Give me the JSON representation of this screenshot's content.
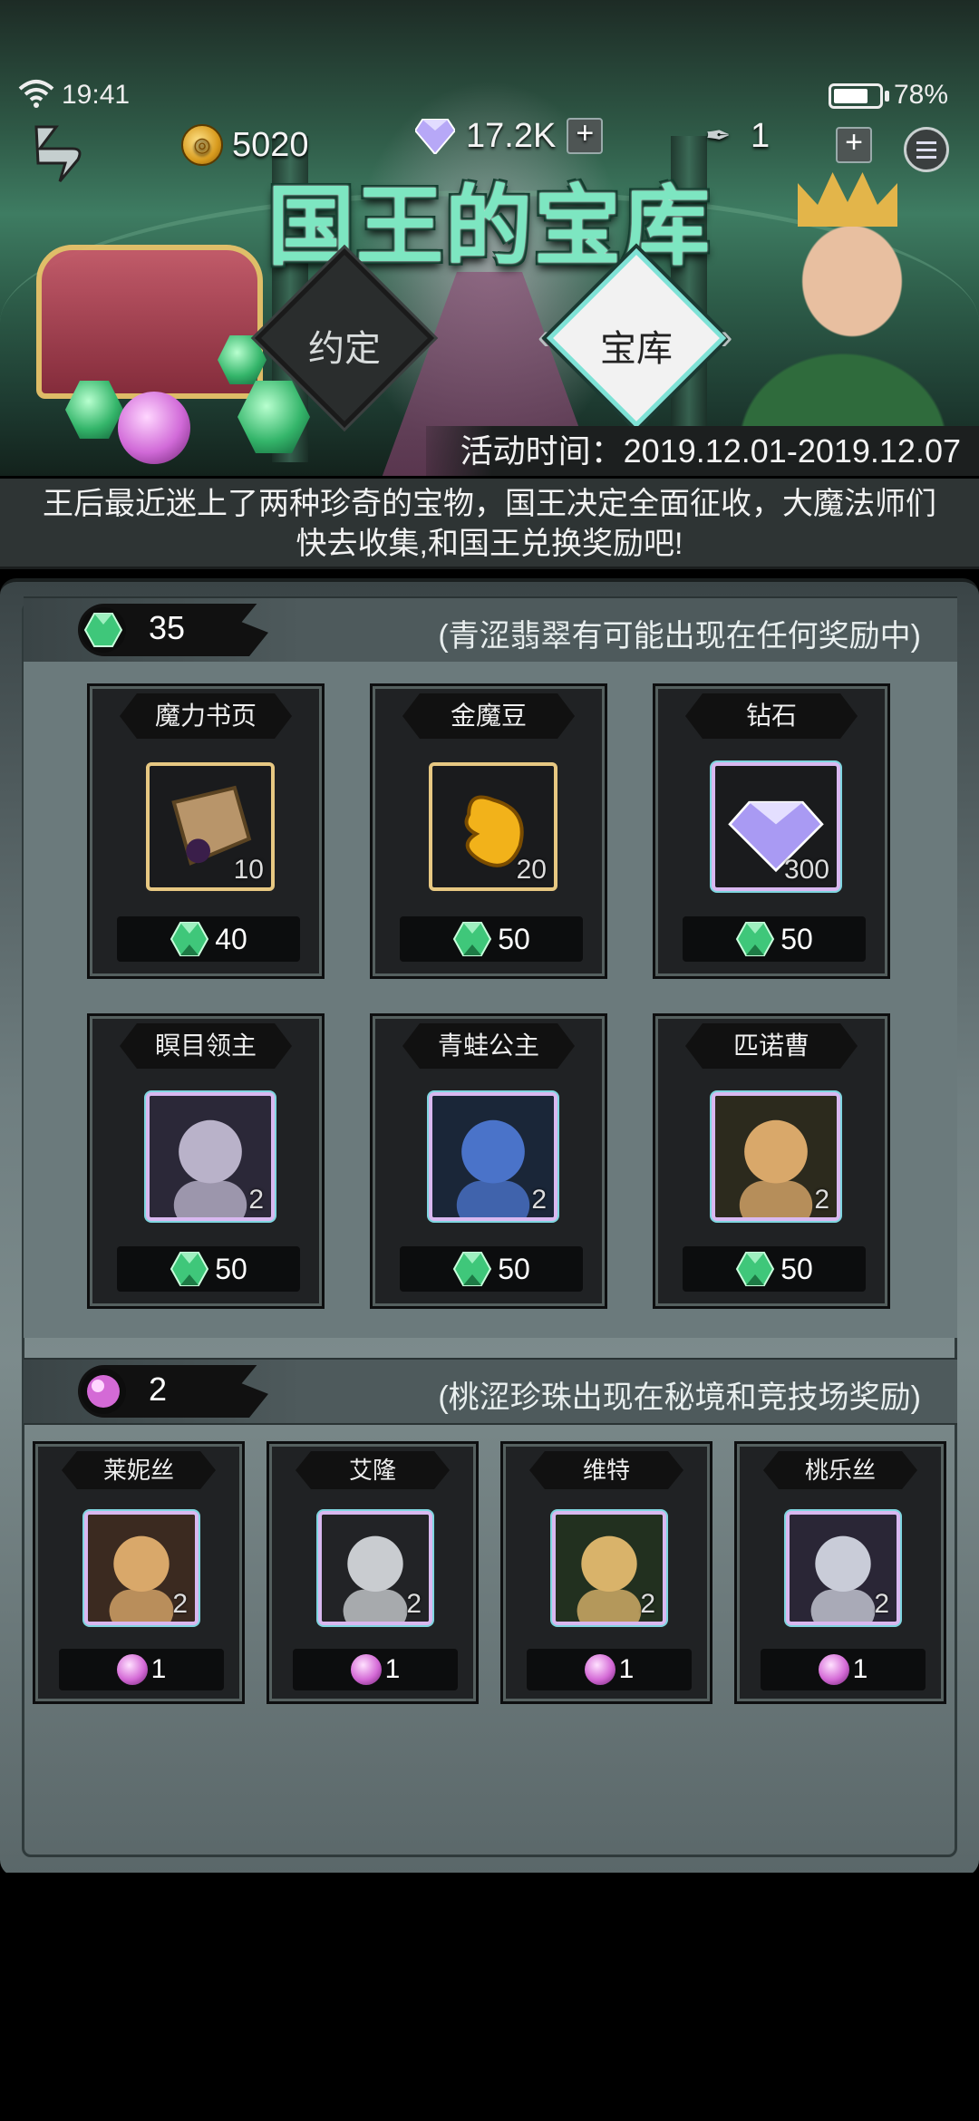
{
  "status": {
    "time": "19:41",
    "battery": "78%",
    "battery_level": 0.78
  },
  "header": {
    "gold": "5020",
    "diamonds": "17.2K",
    "ink": "1",
    "title": "国王的宝库",
    "tabs": [
      {
        "label": "约定",
        "active": false
      },
      {
        "label": "宝库",
        "active": true
      }
    ],
    "event_time": "活动时间：2019.12.01-2019.12.07",
    "description_line1": "王后最近迷上了两种珍奇的宝物，国王决定全面征收，大魔法师们",
    "description_line2": "快去收集,和国王兑换奖励吧!"
  },
  "emerald_section": {
    "count": "35",
    "note": "(青涩翡翠有可能出现在任何奖励中)",
    "items": [
      {
        "name": "魔力书页",
        "qty": "10",
        "price": "40",
        "icon": "magic-page-icon"
      },
      {
        "name": "金魔豆",
        "qty": "20",
        "price": "50",
        "icon": "golden-bean-icon"
      },
      {
        "name": "钻石",
        "qty": "300",
        "price": "50",
        "icon": "diamond-icon"
      },
      {
        "name": "瞑目领主",
        "qty": "2",
        "price": "50",
        "icon": "hooded-lord-portrait"
      },
      {
        "name": "青蛙公主",
        "qty": "2",
        "price": "50",
        "icon": "frog-princess-portrait"
      },
      {
        "name": "匹诺曹",
        "qty": "2",
        "price": "50",
        "icon": "pinocchio-portrait"
      }
    ]
  },
  "pearl_section": {
    "count": "2",
    "note": "(桃涩珍珠出现在秘境和竞技场奖励)",
    "items": [
      {
        "name": "莱妮丝",
        "qty": "2",
        "price": "1",
        "icon": "lenis-portrait"
      },
      {
        "name": "艾隆",
        "qty": "2",
        "price": "1",
        "icon": "aron-portrait"
      },
      {
        "name": "维特",
        "qty": "2",
        "price": "1",
        "icon": "vitte-portrait"
      },
      {
        "name": "桃乐丝",
        "qty": "2",
        "price": "1",
        "icon": "dorothy-portrait"
      }
    ]
  },
  "colors": {
    "emerald": "#34b56a",
    "pearl": "#d16ad8",
    "gold_frame": "#e7c882",
    "title_green": "#7de6c1"
  }
}
